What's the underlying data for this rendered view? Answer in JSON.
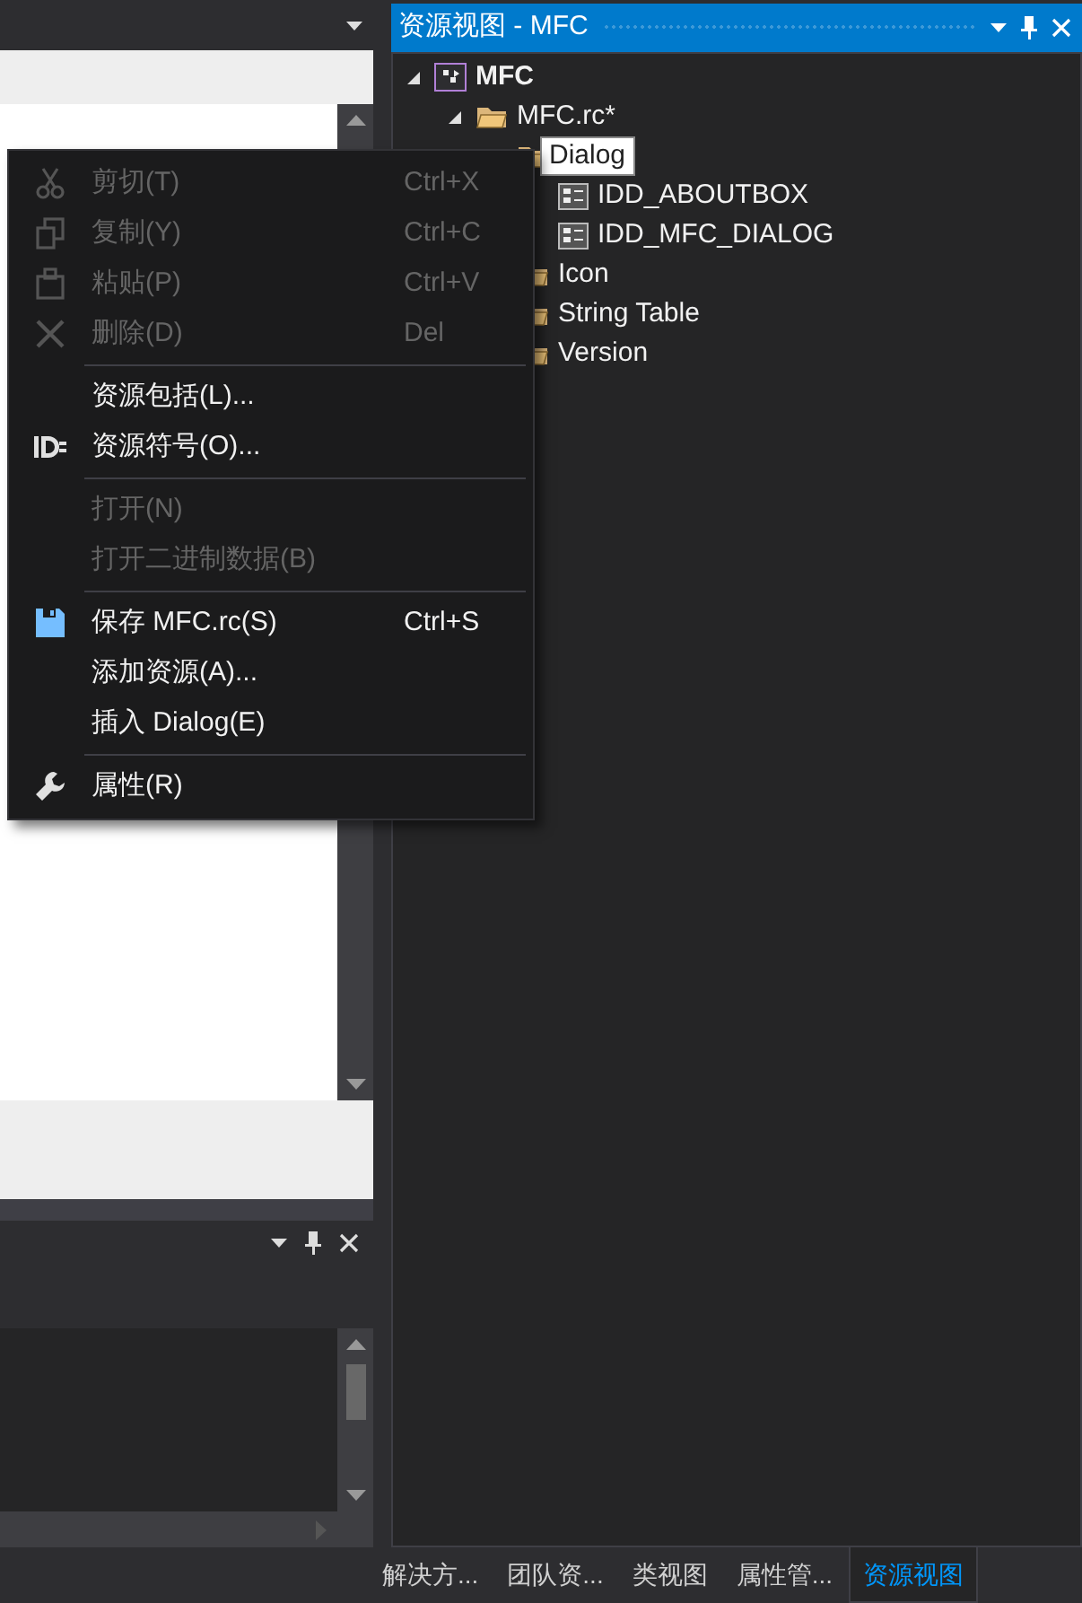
{
  "resource_view": {
    "title": "资源视图 - MFC",
    "tree": [
      {
        "label": "MFC",
        "kind": "project",
        "expanded": true,
        "children": [
          {
            "label": "MFC.rc*",
            "kind": "folder",
            "expanded": true,
            "children": [
              {
                "label": "Dialog",
                "kind": "folder",
                "tooltip": true,
                "children": [
                  {
                    "label": "IDD_ABOUTBOX",
                    "kind": "dialog"
                  },
                  {
                    "label": "IDD_MFC_DIALOG",
                    "kind": "dialog"
                  }
                ]
              },
              {
                "label": "Icon",
                "kind": "folder"
              },
              {
                "label": "String Table",
                "kind": "folder"
              },
              {
                "label": "Version",
                "kind": "folder"
              }
            ]
          }
        ]
      }
    ]
  },
  "context_menu": [
    {
      "kind": "cut",
      "label": "剪切(T)",
      "shortcut": "Ctrl+X",
      "disabled": true
    },
    {
      "kind": "copy",
      "label": "复制(Y)",
      "shortcut": "Ctrl+C",
      "disabled": true
    },
    {
      "kind": "paste",
      "label": "粘贴(P)",
      "shortcut": "Ctrl+V",
      "disabled": true
    },
    {
      "kind": "delete",
      "label": "删除(D)",
      "shortcut": "Del",
      "disabled": true
    },
    {
      "kind": "separator"
    },
    {
      "kind": "plain",
      "label": "资源包括(L)...",
      "disabled": false
    },
    {
      "kind": "id",
      "label": "资源符号(O)...",
      "disabled": false
    },
    {
      "kind": "separator"
    },
    {
      "kind": "plain",
      "label": "打开(N)",
      "disabled": true
    },
    {
      "kind": "plain",
      "label": "打开二进制数据(B)",
      "disabled": true
    },
    {
      "kind": "separator"
    },
    {
      "kind": "save",
      "label": "保存 MFC.rc(S)",
      "shortcut": "Ctrl+S",
      "disabled": false
    },
    {
      "kind": "plain",
      "label": "添加资源(A)...",
      "disabled": false
    },
    {
      "kind": "plain",
      "label": "插入 Dialog(E)",
      "disabled": false
    },
    {
      "kind": "separator"
    },
    {
      "kind": "wrench",
      "label": "属性(R)",
      "disabled": false
    }
  ],
  "bottom_tabs": [
    {
      "label": "解决方...",
      "selected": false
    },
    {
      "label": "团队资...",
      "selected": false
    },
    {
      "label": "类视图",
      "selected": false
    },
    {
      "label": "属性管...",
      "selected": false
    },
    {
      "label": "资源视图",
      "selected": true
    }
  ]
}
